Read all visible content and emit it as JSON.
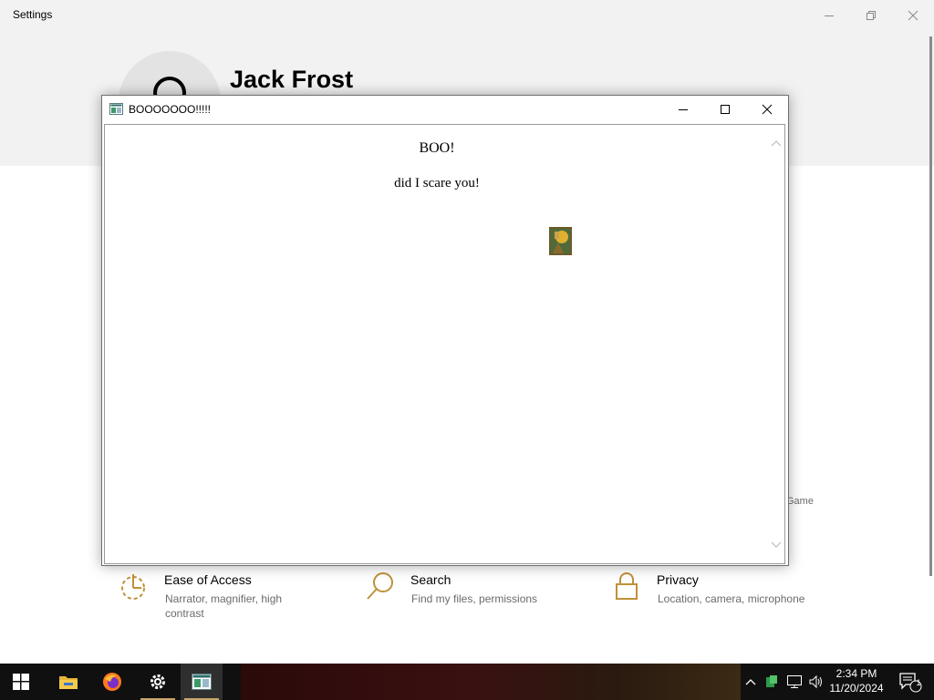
{
  "settings": {
    "window_title": "Settings",
    "user_name": "Jack Frost",
    "peek_text": "Game",
    "categories": [
      {
        "title": "Ease of Access",
        "desc_line1": "Narrator, magnifier, high",
        "desc_line2": "contrast",
        "icon": "ease-of-access-icon"
      },
      {
        "title": "Search",
        "desc_line1": "Find my files, permissions",
        "desc_line2": "",
        "icon": "search-icon"
      },
      {
        "title": "Privacy",
        "desc_line1": "Location, camera, microphone",
        "desc_line2": "",
        "icon": "lock-icon"
      }
    ]
  },
  "popup": {
    "title": "BOOOOOOO!!!!!",
    "heading": "BOO!",
    "text": "did I scare you!"
  },
  "taskbar": {
    "time": "2:34 PM",
    "date": "11/20/2024",
    "notification_count": "1",
    "pinned": [
      "start",
      "file-explorer",
      "firefox",
      "settings",
      "boo-app"
    ]
  },
  "colors": {
    "accent_gold": "#c0913a",
    "taskbar": "#101010",
    "settings_header": "#f2f2f2"
  }
}
